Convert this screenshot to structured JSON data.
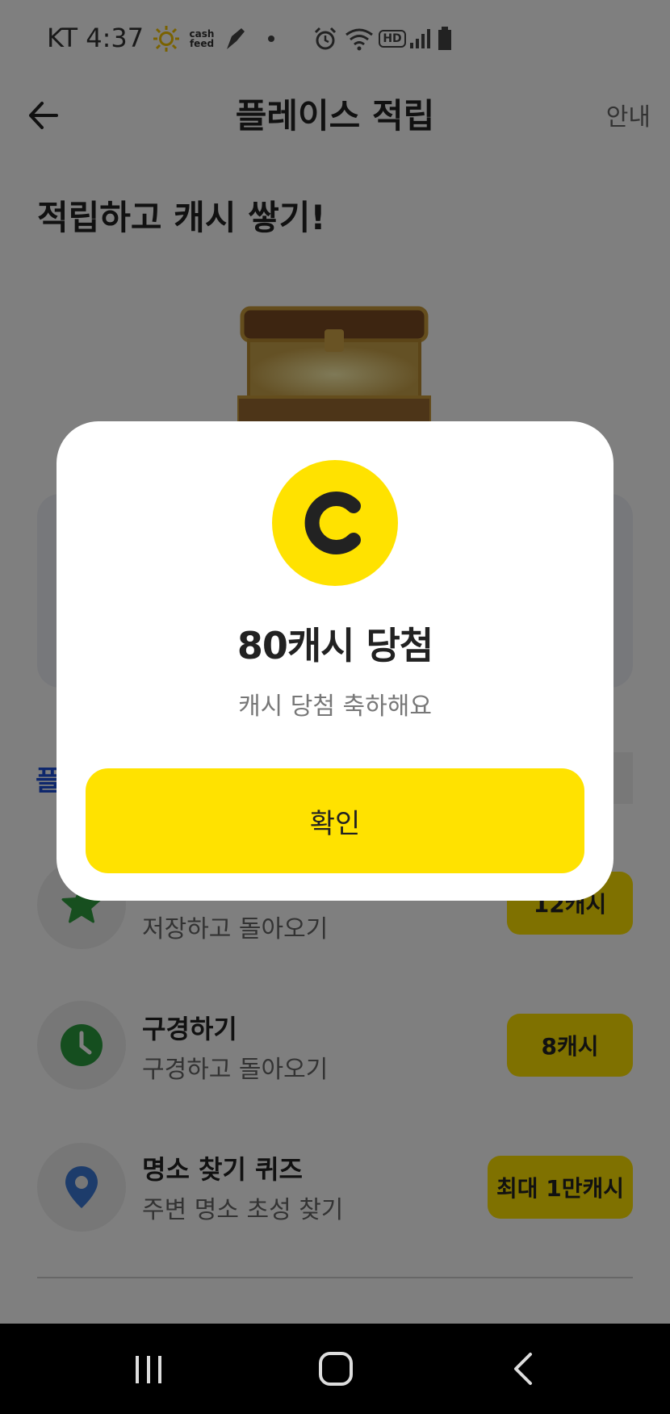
{
  "status_bar": {
    "carrier_time": "KT 4:37",
    "cashfeed_label": "cash feed",
    "icons": [
      "sun-app-icon",
      "cashfeed-icon",
      "pen-app-icon",
      "dot-icon",
      "alarm-icon",
      "wifi-icon",
      "hd-icon",
      "signal-icon",
      "battery-icon"
    ],
    "hd_label": "HD"
  },
  "header": {
    "title": "플레이스 적립",
    "guide_label": "안내"
  },
  "headline": "적립하고 캐시 쌓기!",
  "partial_label": "플",
  "missions": [
    {
      "title": "",
      "subtitle": "저장하고 돌아오기",
      "reward": "12캐시",
      "icon": "star-icon"
    },
    {
      "title": "구경하기",
      "subtitle": "구경하고 돌아오기",
      "reward": "8캐시",
      "icon": "clock-icon"
    },
    {
      "title": "명소 찾기 퀴즈",
      "subtitle": "주변 명소 초성 찾기",
      "reward": "최대 1만캐시",
      "icon": "location-pin-icon"
    }
  ],
  "modal": {
    "coin_letter": "C",
    "title": "80캐시 당첨",
    "subtitle": "캐시 당첨 축하해요",
    "confirm_label": "확인"
  },
  "colors": {
    "accent_yellow": "#ffe200",
    "star_green": "#2e9e3e",
    "clock_green": "#2a9d3f",
    "pin_blue": "#3a78d6",
    "link_blue": "#1d4fd8"
  },
  "nav": {
    "icons": [
      "recent-apps-icon",
      "home-icon",
      "back-nav-icon"
    ]
  }
}
